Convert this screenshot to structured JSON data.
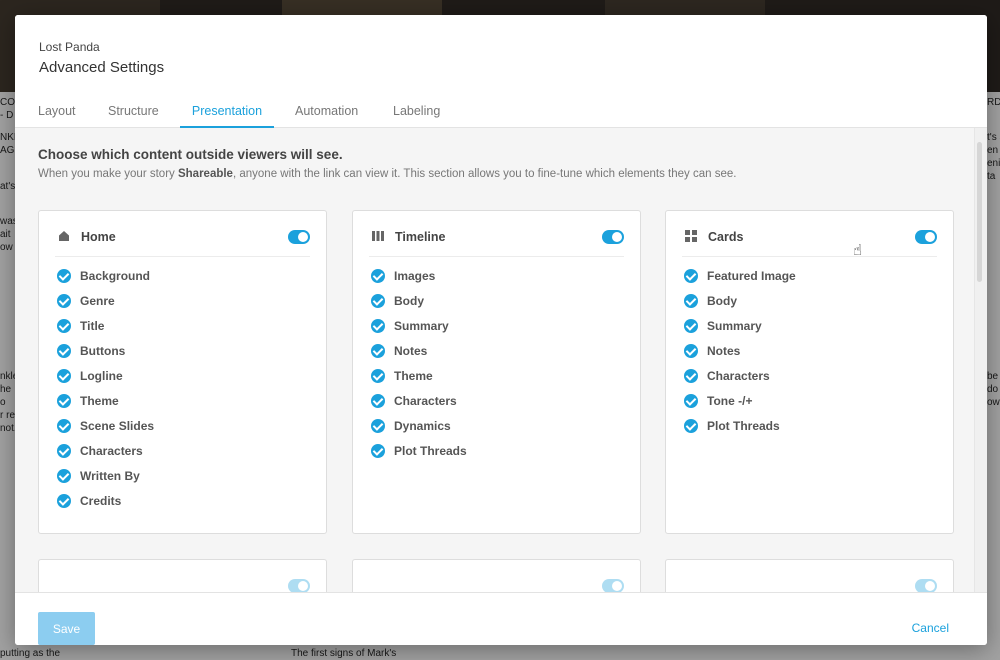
{
  "background": {
    "left_fragments": [
      "CO",
      "- D",
      "NKL",
      "AGE",
      "at's",
      "was",
      "ait",
      "ow",
      "nkle",
      "he",
      "o",
      "r re",
      "not."
    ],
    "right_fragments": [
      "RDS",
      "t's a",
      "en a",
      "enix",
      "ta",
      "be i",
      "do",
      "ow"
    ],
    "bottom_left": "putting as the",
    "bottom_mid": "The first signs of Mark's"
  },
  "modal": {
    "subtitle": "Lost Panda",
    "title": "Advanced Settings",
    "tabs": [
      {
        "label": "Layout"
      },
      {
        "label": "Structure"
      },
      {
        "label": "Presentation"
      },
      {
        "label": "Automation"
      },
      {
        "label": "Labeling"
      }
    ],
    "active_tab": "Presentation",
    "intro": {
      "heading": "Choose which content outside viewers will see.",
      "text_before": "When you make your story ",
      "text_bold": "Shareable",
      "text_after": ", anyone with the link can view it. This section allows you to fine-tune which elements they can see."
    },
    "cards": [
      {
        "title": "Home",
        "icon": "home-icon",
        "enabled": true,
        "items": [
          "Background",
          "Genre",
          "Title",
          "Buttons",
          "Logline",
          "Theme",
          "Scene Slides",
          "Characters",
          "Written By",
          "Credits"
        ]
      },
      {
        "title": "Timeline",
        "icon": "columns-icon",
        "enabled": true,
        "items": [
          "Images",
          "Body",
          "Summary",
          "Notes",
          "Theme",
          "Characters",
          "Dynamics",
          "Plot Threads"
        ]
      },
      {
        "title": "Cards",
        "icon": "grid-icon",
        "enabled": true,
        "items": [
          "Featured Image",
          "Body",
          "Summary",
          "Notes",
          "Characters",
          "Tone -/+",
          "Plot Threads"
        ]
      }
    ],
    "footer": {
      "save_label": "Save",
      "cancel_label": "Cancel"
    }
  },
  "colors": {
    "accent": "#1ba1dc",
    "save_disabled": "#8ccdf0"
  }
}
